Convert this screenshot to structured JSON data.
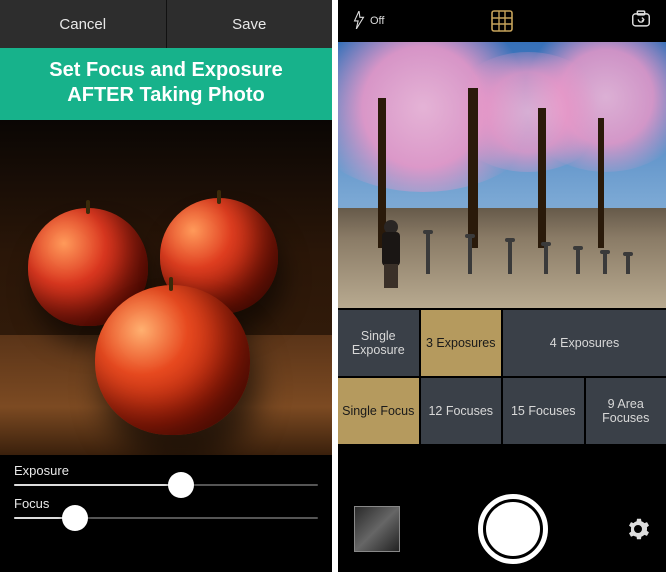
{
  "left": {
    "topbar": {
      "cancel": "Cancel",
      "save": "Save"
    },
    "banner": {
      "line1": "Set Focus and Exposure",
      "line2": "AFTER Taking Photo"
    },
    "sliders": {
      "exposure": {
        "label": "Exposure",
        "value": 55
      },
      "focus": {
        "label": "Focus",
        "value": 20
      }
    }
  },
  "right": {
    "flash": {
      "label": "Off"
    },
    "exposure_options": [
      {
        "label": "Single Exposure",
        "selected": false
      },
      {
        "label": "3 Exposures",
        "selected": true
      },
      {
        "label": "4 Exposures",
        "selected": false
      }
    ],
    "focus_options": [
      {
        "label": "Single Focus",
        "selected": true
      },
      {
        "label": "12 Focuses",
        "selected": false
      },
      {
        "label": "15 Focuses",
        "selected": false
      },
      {
        "label": "9 Area Focuses",
        "selected": false
      }
    ]
  }
}
